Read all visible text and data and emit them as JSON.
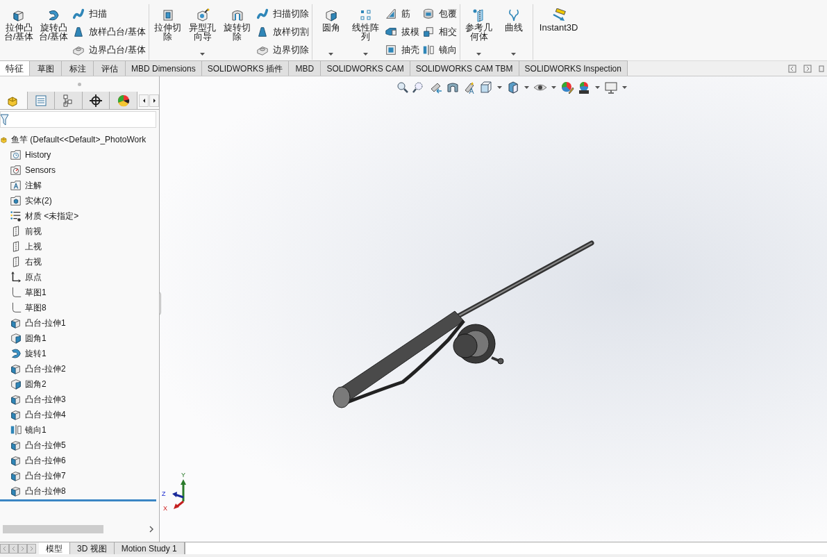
{
  "ribbon": {
    "groups": [
      {
        "items": [
          {
            "kind": "large",
            "label": "拉伸凸台/基体",
            "dropdown": false
          },
          {
            "kind": "large",
            "label": "旋转凸台/基体",
            "dropdown": false
          },
          {
            "kind": "stack",
            "entries": [
              {
                "label": "扫描"
              },
              {
                "label": "放样凸台/基体"
              },
              {
                "label": "边界凸台/基体"
              }
            ]
          }
        ]
      },
      {
        "items": [
          {
            "kind": "large",
            "label": "拉伸切除",
            "dropdown": false
          },
          {
            "kind": "large",
            "label": "异型孔向导",
            "dropdown": true
          },
          {
            "kind": "large",
            "label": "旋转切除",
            "dropdown": false
          },
          {
            "kind": "stack",
            "entries": [
              {
                "label": "扫描切除"
              },
              {
                "label": "放样切割"
              },
              {
                "label": "边界切除"
              }
            ]
          }
        ]
      },
      {
        "items": [
          {
            "kind": "large",
            "label": "圆角",
            "dropdown": true
          },
          {
            "kind": "large",
            "label": "线性阵列",
            "dropdown": true
          },
          {
            "kind": "stack",
            "entries": [
              {
                "label": "筋"
              },
              {
                "label": "拔模"
              },
              {
                "label": "抽壳"
              }
            ]
          },
          {
            "kind": "stack",
            "entries": [
              {
                "label": "包覆"
              },
              {
                "label": "相交"
              },
              {
                "label": "镜向"
              }
            ]
          }
        ]
      },
      {
        "items": [
          {
            "kind": "large",
            "label": "参考几何体",
            "dropdown": true
          },
          {
            "kind": "large",
            "label": "曲线",
            "dropdown": true
          }
        ]
      },
      {
        "items": [
          {
            "kind": "large",
            "label": "Instant3D",
            "dropdown": false
          }
        ]
      }
    ]
  },
  "tabs": [
    {
      "label": "特征",
      "selected": true
    },
    {
      "label": "草图",
      "selected": false
    },
    {
      "label": "标注",
      "selected": false
    },
    {
      "label": "评估",
      "selected": false
    },
    {
      "label": "MBD Dimensions",
      "selected": false
    },
    {
      "label": "SOLIDWORKS 插件",
      "selected": false
    },
    {
      "label": "MBD",
      "selected": false
    },
    {
      "label": "SOLIDWORKS CAM",
      "selected": false
    },
    {
      "label": "SOLIDWORKS CAM TBM",
      "selected": false
    },
    {
      "label": "SOLIDWORKS Inspection",
      "selected": false
    }
  ],
  "panel_tabs": [
    {
      "selected": true
    },
    {
      "selected": false
    },
    {
      "selected": false
    },
    {
      "selected": false
    },
    {
      "selected": false
    }
  ],
  "tree": {
    "root": "鱼竿  (Default<<Default>_PhotoWork",
    "items": [
      {
        "label": "History"
      },
      {
        "label": "Sensors"
      },
      {
        "label": "注解"
      },
      {
        "label": "实体(2)"
      },
      {
        "label": "材质 <未指定>"
      },
      {
        "label": "前视"
      },
      {
        "label": "上视"
      },
      {
        "label": "右视"
      },
      {
        "label": "原点"
      },
      {
        "label": "草图1"
      },
      {
        "label": "草图8"
      },
      {
        "label": "凸台-拉伸1"
      },
      {
        "label": "圆角1"
      },
      {
        "label": "旋转1"
      },
      {
        "label": "凸台-拉伸2"
      },
      {
        "label": "圆角2"
      },
      {
        "label": "凸台-拉伸3"
      },
      {
        "label": "凸台-拉伸4"
      },
      {
        "label": "镜向1"
      },
      {
        "label": "凸台-拉伸5"
      },
      {
        "label": "凸台-拉伸6"
      },
      {
        "label": "凸台-拉伸7"
      },
      {
        "label": "凸台-拉伸8"
      }
    ]
  },
  "triad": {
    "y": "Y",
    "z": "Z",
    "x": "X"
  },
  "bottom_tabs": [
    {
      "label": "模型",
      "selected": true
    },
    {
      "label": "3D 视图",
      "selected": false
    },
    {
      "label": "Motion Study 1",
      "selected": false
    }
  ]
}
